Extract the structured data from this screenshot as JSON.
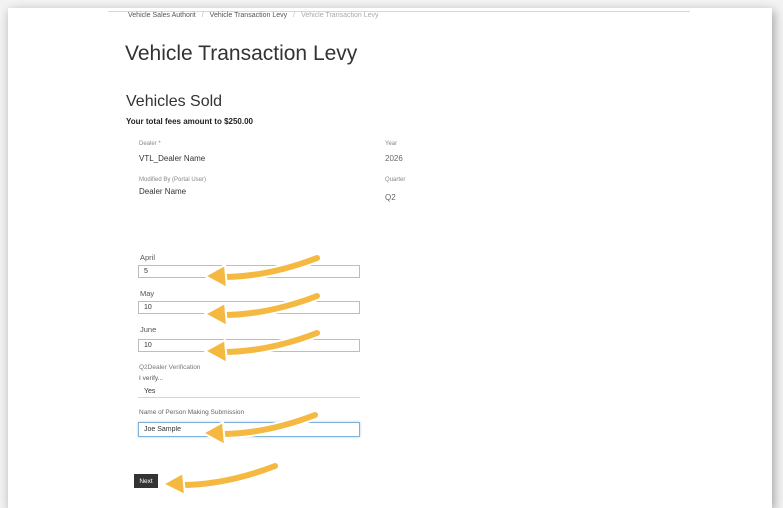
{
  "breadcrumb": {
    "items": [
      "Vehicle Sales Authorit",
      "Vehicle Transaction Levy",
      "Vehicle Transaction Levy"
    ]
  },
  "page": {
    "title": "Vehicle Transaction Levy",
    "section_title": "Vehicles Sold",
    "fees_text": "Your total fees amount to $250.00"
  },
  "info": {
    "dealer_label": "Dealer *",
    "dealer_value": "VTL_Dealer Name",
    "year_label": "Year",
    "year_value": "2026",
    "modified_label": "Modified By (Portal User)",
    "modified_value": "Dealer Name",
    "quarter_label": "Quarter",
    "quarter_value": "Q2"
  },
  "form": {
    "april_label": "April",
    "april_value": "5",
    "may_label": "May",
    "may_value": "10",
    "june_label": "June",
    "june_value": "10",
    "verification_label": "Q2Dealer Verification",
    "verify_label": "I verify...",
    "verify_value": "Yes",
    "person_label": "Name of Person Making Submission",
    "person_value": "Joe Sample",
    "next_label": "Next"
  },
  "colors": {
    "arrow": "#f5b942",
    "arrow_outline": "#ffffff",
    "button": "#333333"
  }
}
